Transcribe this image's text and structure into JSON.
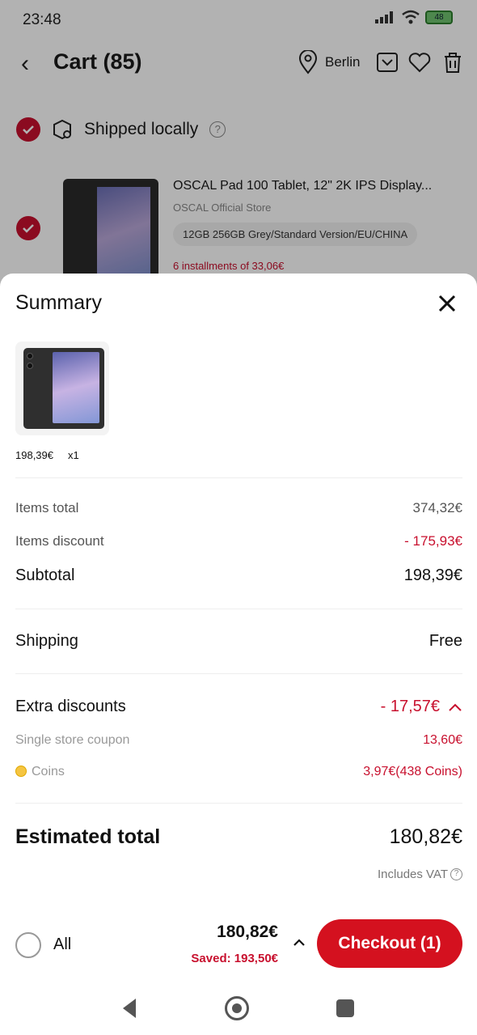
{
  "status": {
    "time": "23:48",
    "battery": "48"
  },
  "header": {
    "title": "Cart (85)",
    "location": "Berlin"
  },
  "cart": {
    "section_label": "Shipped locally",
    "item": {
      "title": "OSCAL Pad 100 Tablet, 12\" 2K IPS Display...",
      "store": "OSCAL Official Store",
      "variant": "12GB 256GB Grey/Standard Version/EU/CHINA",
      "installments": "6 installments of 33,06€"
    }
  },
  "summary": {
    "title": "Summary",
    "item_price": "198,39€",
    "item_qty": "x1",
    "items_total_label": "Items total",
    "items_total_value": "374,32€",
    "items_discount_label": "Items discount",
    "items_discount_value": "- 175,93€",
    "subtotal_label": "Subtotal",
    "subtotal_value": "198,39€",
    "shipping_label": "Shipping",
    "shipping_value": "Free",
    "extra_discounts_label": "Extra discounts",
    "extra_discounts_value": "- 17,57€",
    "coupon_label": "Single store coupon",
    "coupon_value": "13,60€",
    "coins_label": "Coins",
    "coins_value": "3,97€(438 Coins)",
    "estimated_label": "Estimated total",
    "estimated_value": "180,82€",
    "vat_note": "Includes VAT"
  },
  "bottom_bar": {
    "all_label": "All",
    "total": "180,82€",
    "saved": "Saved: 193,50€",
    "checkout_label": "Checkout (1)"
  },
  "colors": {
    "accent_red": "#d4111f",
    "price_red": "#c8102e"
  }
}
